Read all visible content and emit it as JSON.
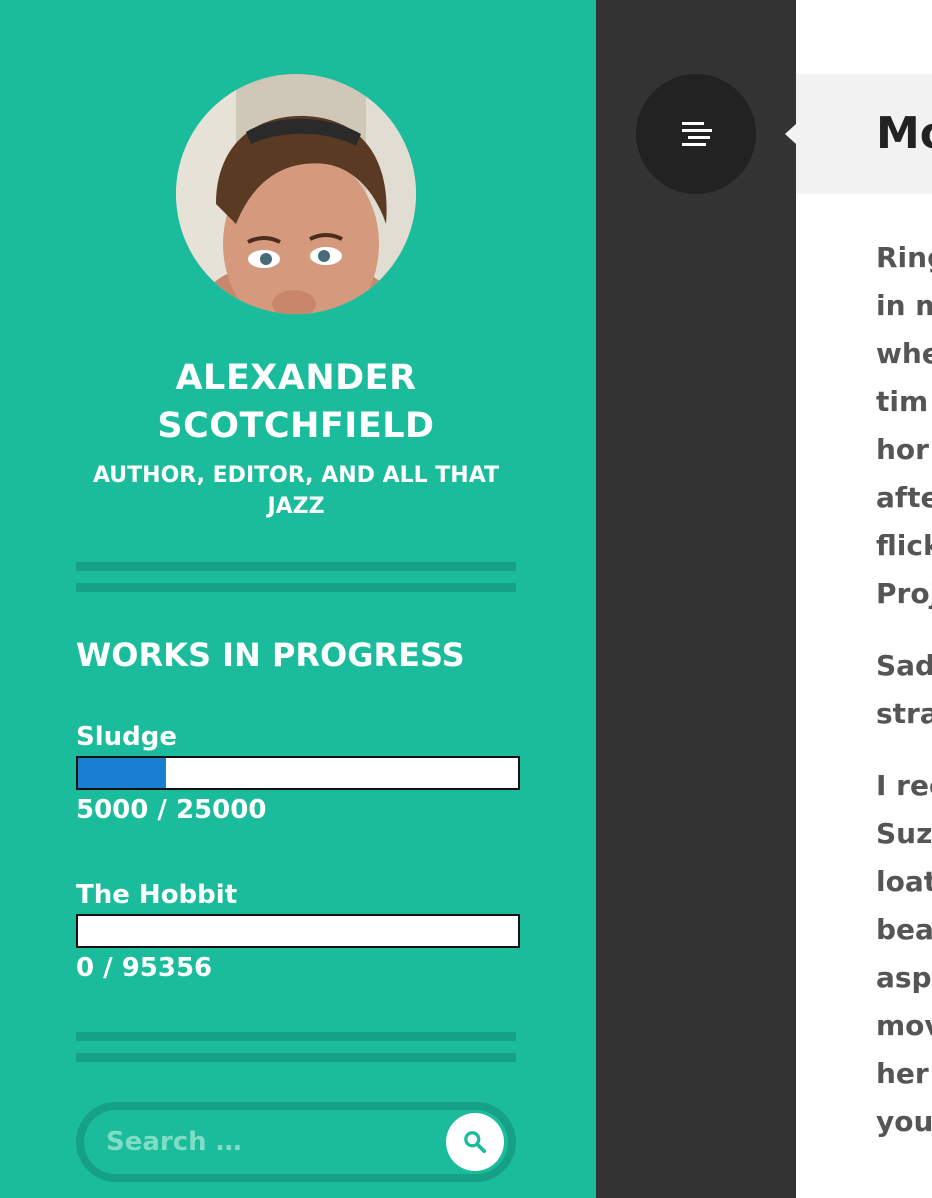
{
  "author": {
    "name": "ALEXANDER SCOTCHFIELD",
    "tagline": "AUTHOR, EDITOR, AND ALL THAT JAZZ"
  },
  "wip": {
    "title": "WORKS IN PROGRESS",
    "items": [
      {
        "title": "Sludge",
        "count": "5000 / 25000",
        "progress": 0.2
      },
      {
        "title": "The Hobbit",
        "count": "0 / 95356",
        "progress": 0.0
      }
    ]
  },
  "search": {
    "placeholder": "Search …"
  },
  "icons": {
    "menu": "menu-lines-icon",
    "search": "magnifier-icon"
  },
  "colors": {
    "sidebar": "#1abc9c",
    "sidebar_accent": "#16a085",
    "progress_fill": "#1b7fd1",
    "dark_column": "#333333",
    "toggle": "#222222"
  },
  "post": {
    "title_partial": "Mo",
    "paragraphs": [
      [
        "Ring",
        "in m",
        "whe",
        "tim",
        "hor",
        "afte",
        "flick",
        "Proj"
      ],
      [
        "Sad",
        "stra"
      ],
      [
        "I rec",
        "Suz",
        "loat",
        "bea",
        "asp",
        "mov",
        "her",
        "you"
      ]
    ]
  }
}
